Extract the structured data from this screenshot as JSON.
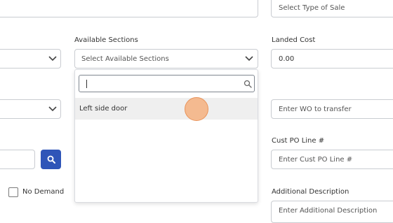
{
  "form": {
    "type_of_sale": {
      "placeholder": "Select Type of Sale"
    },
    "available_sections": {
      "label": "Available Sections",
      "placeholder": "Select Available Sections",
      "dropdown": {
        "search_value": "",
        "options": [
          {
            "label": "Left side door"
          }
        ]
      }
    },
    "landed_cost": {
      "label": "Landed Cost",
      "value": "0.00"
    },
    "wo_transfer": {
      "placeholder": "Enter WO to transfer"
    },
    "cust_po_line": {
      "label": "Cust PO Line #",
      "placeholder": "Enter Cust PO Line #"
    },
    "no_demand": {
      "label": "No Demand",
      "checked": false
    },
    "additional_description": {
      "label": "Additional Description",
      "placeholder": "Enter Additional Description"
    }
  },
  "colors": {
    "primary": "#2f55b8",
    "cursor_highlight": "#f6a870",
    "border": "#c9ccd1",
    "option_hover": "#efefef"
  },
  "icons": {
    "chevron": "chevron-down-icon",
    "search": "search-icon"
  }
}
